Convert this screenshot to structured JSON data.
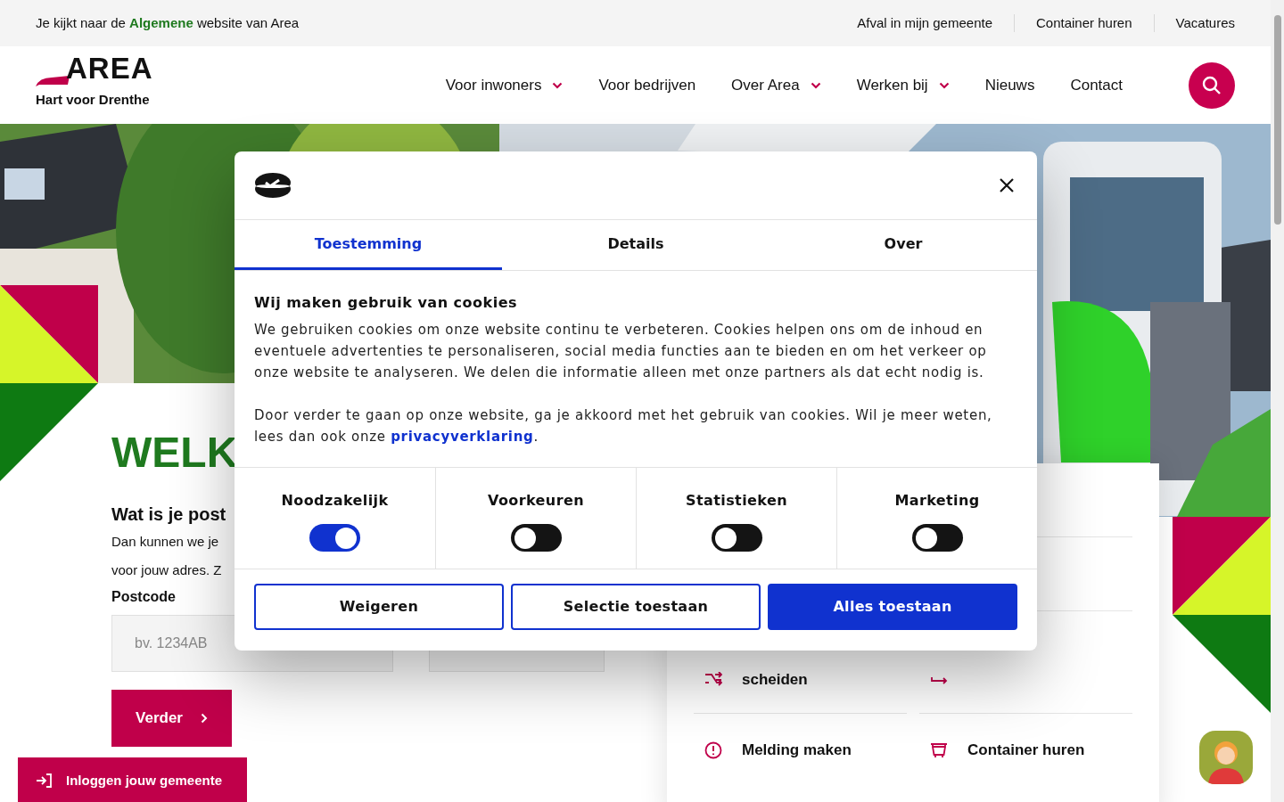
{
  "top_bar": {
    "notice": "Je kijkt naar de **Algemene** website van Area",
    "links": [
      "Afval in mijn gemeente",
      "Container huren",
      "Vacatures"
    ]
  },
  "header": {
    "logo": {
      "wordmark": "AREA",
      "tagline": "Hart voor Drenthe"
    },
    "nav": [
      {
        "label": "Voor inwoners",
        "dropdown": true
      },
      {
        "label": "Voor bedrijven",
        "dropdown": false
      },
      {
        "label": "Over Area",
        "dropdown": true
      },
      {
        "label": "Werken bij",
        "dropdown": true
      },
      {
        "label": "Nieuws",
        "dropdown": false
      },
      {
        "label": "Contact",
        "dropdown": false
      }
    ]
  },
  "hero": {
    "welcome_title": "WELK",
    "postcode_form": {
      "title": "Wat is je post",
      "description_lines": [
        "Dan kunnen we je",
        "voor jouw adres. Z"
      ],
      "label": "Postcode",
      "placeholder": "bv. 1234AB",
      "submit": "Verder"
    },
    "login_button": "Inloggen jouw gemeente"
  },
  "quick_links": [
    {
      "kind": "sort",
      "label": "scheiden"
    },
    {
      "kind": "swap"
    },
    {
      "kind": "alert",
      "label": "Melding maken"
    },
    {
      "kind": "cart",
      "label": "Container huren"
    }
  ],
  "cookie_dialog": {
    "tabs": [
      {
        "label": "Toestemming",
        "selected": true
      },
      {
        "label": "Details",
        "selected": false
      },
      {
        "label": "Over",
        "selected": false
      }
    ],
    "title": "Wij maken gebruik van cookies",
    "paragraph": "We gebruiken cookies om onze website continu te verbeteren. Cookies helpen ons om de inhoud en eventuele advertenties te personaliseren, social media functies aan te bieden en om het verkeer op onze website te analyseren. We delen die informatie alleen met onze partners als dat echt nodig is.",
    "consent_text": {
      "text": "Door verder te gaan op onze website, ga je akkoord met het gebruik van cookies. Wil je meer weten, lees dan ook onze",
      "link": "privacyverklaring",
      "after": "."
    },
    "categories": [
      {
        "label": "Noodzakelijk",
        "on": true
      },
      {
        "label": "Voorkeuren",
        "on": false
      },
      {
        "label": "Statistieken",
        "on": false
      },
      {
        "label": "Marketing",
        "on": false
      }
    ],
    "buttons": [
      {
        "label": "Weigeren",
        "kind": "outline"
      },
      {
        "label": "Selectie toestaan",
        "kind": "outline"
      },
      {
        "label": "Alles toestaan",
        "kind": "primary"
      }
    ]
  }
}
